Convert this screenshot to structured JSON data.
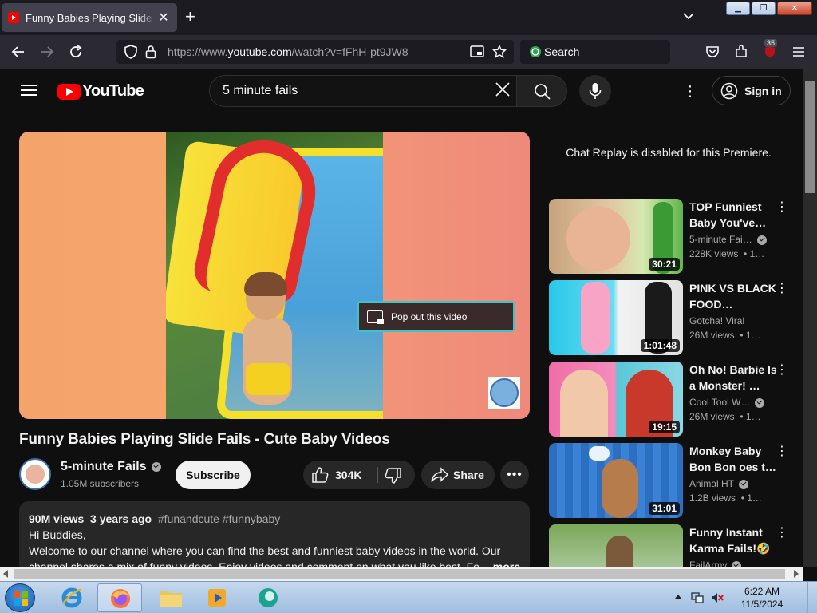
{
  "browser": {
    "tab_title": "Funny Babies Playing Slide Fails - Cute Baby Videos - YouTube",
    "url_prefix": "https://www.",
    "url_domain": "youtube.com",
    "url_path": "/watch?v=fFhH-pt9JW8",
    "search_placeholder": "Search",
    "extensions_badge": "35"
  },
  "yt": {
    "logo_text": "YouTube",
    "search_value": "5 minute fails",
    "signin_label": "Sign in"
  },
  "player": {
    "popout_label": "Pop out this video"
  },
  "video": {
    "title": "Funny Babies Playing Slide Fails - Cute Baby Videos",
    "channel": "5-minute Fails",
    "subscribers": "1.05M subscribers",
    "subscribe_label": "Subscribe",
    "likes": "304K",
    "share_label": "Share",
    "views": "90M views",
    "age": "3 years ago",
    "tags": "#funandcute #funnybaby",
    "desc_line1": "Hi Buddies,",
    "desc_line2": "Welcome to our channel where you can find the best and funniest baby videos in the world. Our",
    "desc_line3": "channel shares a mix of funny videos. Enjoy videos and comment on what you like best. Foll",
    "more_label": "...more"
  },
  "chat": {
    "message": "Chat Replay is disabled for this Premiere."
  },
  "recommendations": [
    {
      "title": "TOP Funniest Baby You've…",
      "channel": "5-minute Fai…",
      "verified": true,
      "views": "228K views",
      "age": "• 1…",
      "duration": "30:21"
    },
    {
      "title": "PINK VS BLACK FOOD…",
      "channel": "Gotcha! Viral",
      "verified": false,
      "views": "26M views",
      "age": "• 1…",
      "duration": "1:01:48"
    },
    {
      "title": "Oh No! Barbie Is a Monster! …",
      "channel": "Cool Tool W…",
      "verified": true,
      "views": "26M views",
      "age": "• 1…",
      "duration": "19:15"
    },
    {
      "title": "Monkey Baby Bon Bon oes t…",
      "channel": "Animal HT",
      "verified": true,
      "views": "1.2B views",
      "age": "• 1…",
      "duration": "31:01"
    },
    {
      "title": "Funny Instant Karma Fails!🤣",
      "channel": "FailArmy",
      "verified": true,
      "views": "",
      "age": "",
      "duration": ""
    }
  ],
  "taskbar": {
    "time": "6:22 AM",
    "date": "11/5/2024"
  }
}
